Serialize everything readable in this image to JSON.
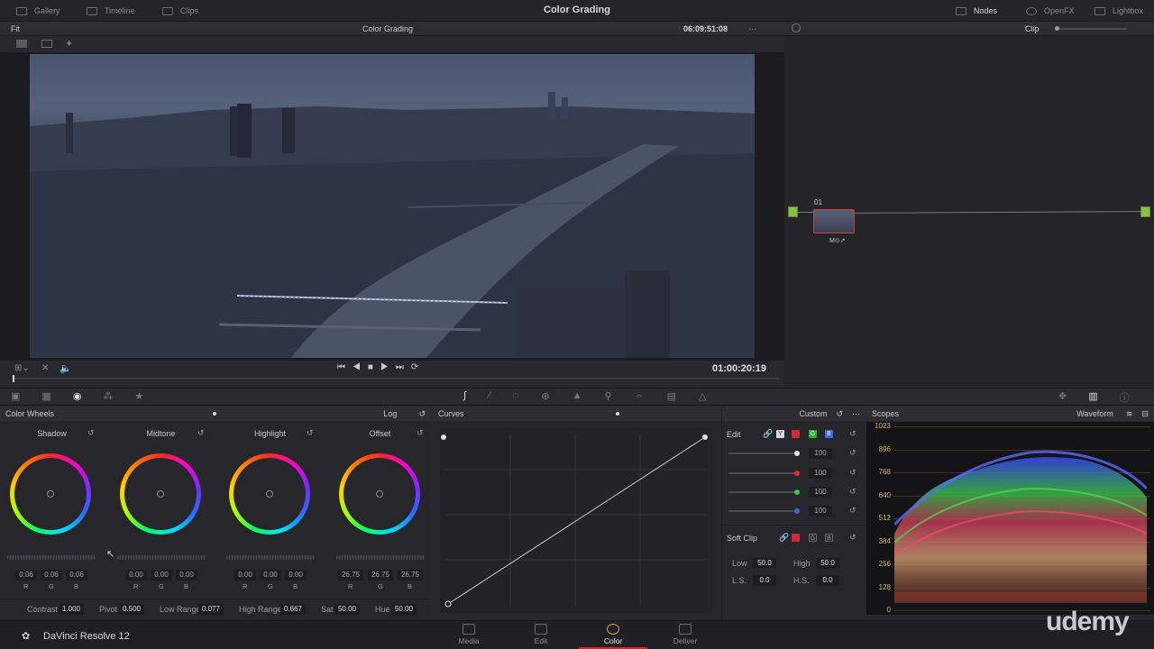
{
  "topnav": {
    "gallery": "Gallery",
    "timeline": "Timeline",
    "clips": "Clips",
    "title": "Color Grading",
    "nodes": "Nodes",
    "openfx": "OpenFX",
    "lightbox": "Lightbox"
  },
  "viewer": {
    "fit": "Fit",
    "clip_name": "Color Grading",
    "source_tc": "06:09:51:08",
    "clip_mode": "Clip",
    "timecode": "01:00:20:19"
  },
  "node": {
    "label": "01"
  },
  "color_wheels": {
    "title": "Color Wheels",
    "mode": "Log",
    "wheels": [
      {
        "name": "Shadow",
        "r": "0.06",
        "g": "0.06",
        "b": "0.06"
      },
      {
        "name": "Midtone",
        "r": "0.00",
        "g": "0.00",
        "b": "0.00"
      },
      {
        "name": "Highlight",
        "r": "0.00",
        "g": "0.00",
        "b": "0.00"
      },
      {
        "name": "Offset",
        "r": "26.75",
        "g": "26.75",
        "b": "26.75"
      }
    ],
    "channel_labels": {
      "r": "R",
      "g": "G",
      "b": "B"
    },
    "params": {
      "contrast_label": "Contrast",
      "contrast": "1.000",
      "pivot_label": "Pivot",
      "pivot": "0.500",
      "low_range_label": "Low Range",
      "low_range": "0.077",
      "high_range_label": "High Range",
      "high_range": "0.667",
      "sat_label": "Sat",
      "sat": "50.00",
      "hue_label": "Hue",
      "hue": "50.00"
    }
  },
  "curves": {
    "title": "Curves",
    "preset": "Custom"
  },
  "edit": {
    "title": "Edit",
    "y": "Y",
    "g": "G",
    "b": "B",
    "values": [
      "100",
      "100",
      "100",
      "100"
    ],
    "slider_colors": [
      "#e0e0e0",
      "#e02a3a",
      "#3ac83a",
      "#3a6ae0"
    ],
    "softclip_title": "Soft Clip",
    "low_label": "Low",
    "low": "50.0",
    "high_label": "High",
    "high": "50.0",
    "ls_label": "L.S.",
    "ls": "0.0",
    "hs_label": "H.S.",
    "hs": "0.0"
  },
  "scopes": {
    "title": "Scopes",
    "mode": "Waveform",
    "y_labels": [
      "1023",
      "896",
      "768",
      "640",
      "512",
      "384",
      "256",
      "128",
      "0"
    ]
  },
  "footer": {
    "app": "DaVinci Resolve 12",
    "media": "Media",
    "edit": "Edit",
    "color": "Color",
    "deliver": "Deliver",
    "watermark": "udemy"
  }
}
